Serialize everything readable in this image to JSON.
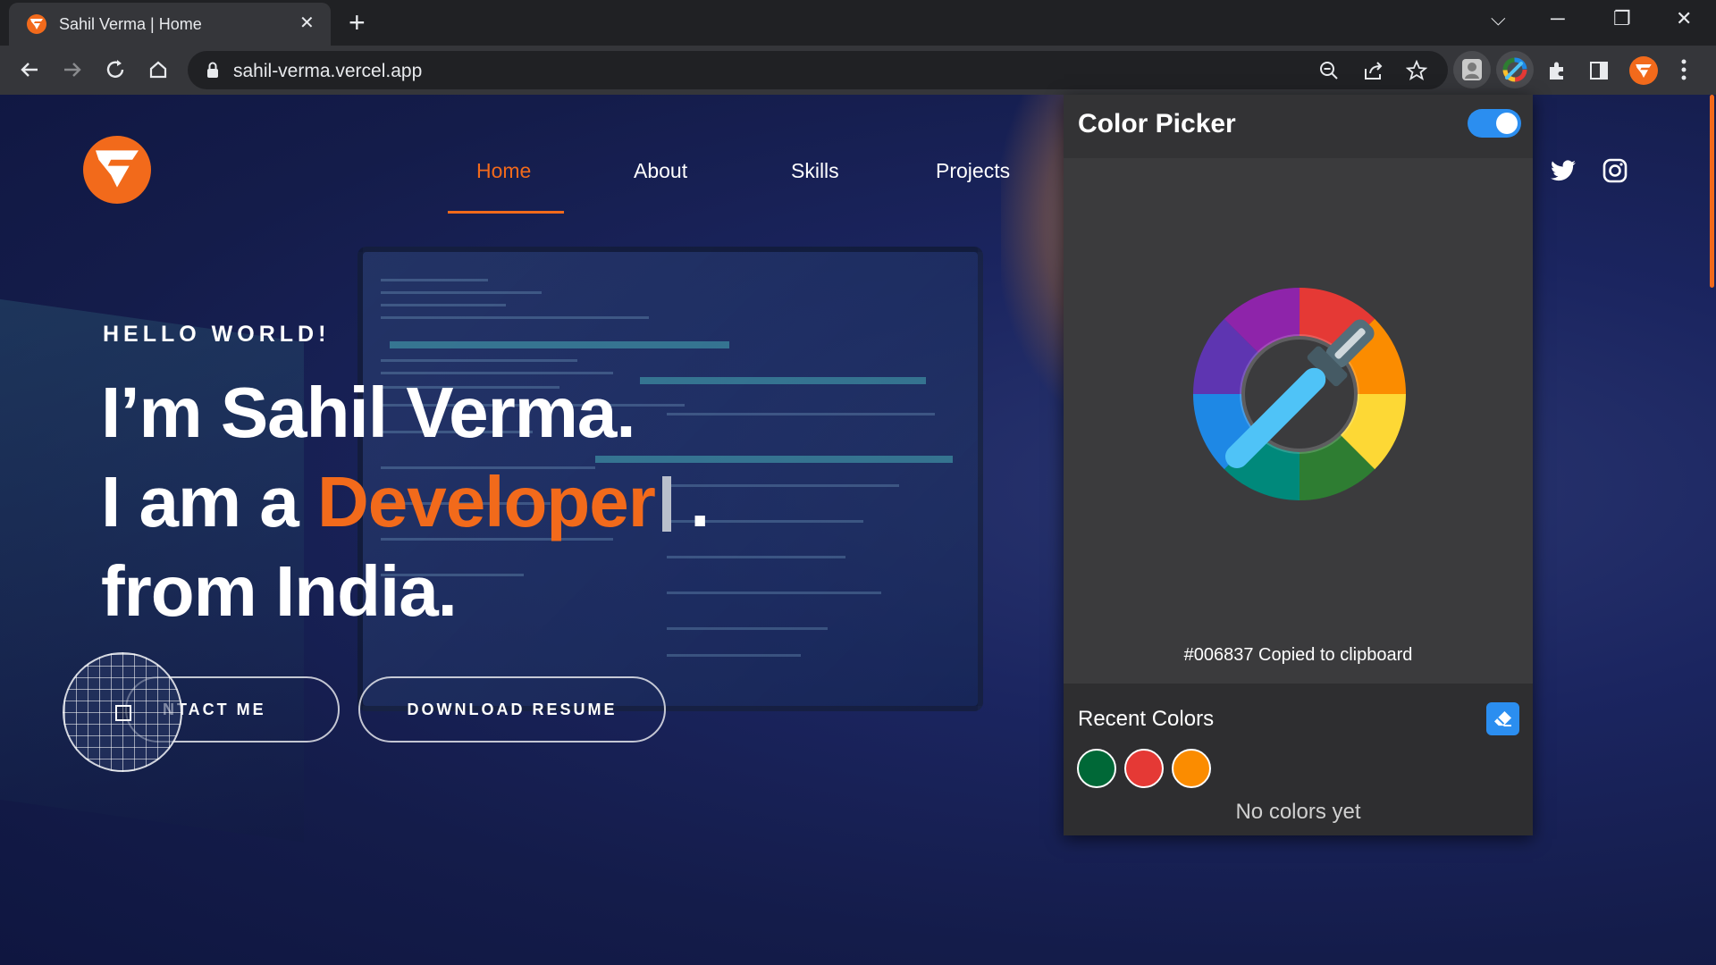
{
  "browser": {
    "tab_title": "Sahil Verma | Home",
    "tab_close": "✕",
    "new_tab": "+",
    "url": "sahil-verma.vercel.app",
    "window_controls": {
      "dropdown": "⌵",
      "minimize": "─",
      "restore": "❐",
      "close": "✕"
    }
  },
  "site": {
    "nav": [
      {
        "label": "Home",
        "active": true
      },
      {
        "label": "About",
        "active": false
      },
      {
        "label": "Skills",
        "active": false
      },
      {
        "label": "Projects",
        "active": false
      }
    ],
    "hero": {
      "greeting": "HELLO WORLD!",
      "line1": "I’m Sahil Verma.",
      "line2_prefix": "I am a ",
      "line2_role": "Developer",
      "line2_suffix": ".",
      "line3": "from India."
    },
    "buttons": {
      "contact": "NTACT ME",
      "resume": "DOWNLOAD RESUME"
    },
    "accent_color": "#f26a1b"
  },
  "extension": {
    "title": "Color Picker",
    "enabled": true,
    "copied_message": "#006837 Copied to clipboard",
    "recent_title": "Recent Colors",
    "recent_colors": [
      "#006837",
      "#e53935",
      "#fb8c00"
    ],
    "empty_message": "No colors yet"
  }
}
